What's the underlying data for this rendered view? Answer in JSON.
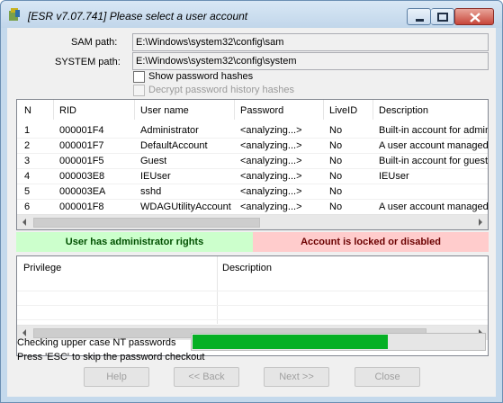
{
  "window": {
    "title": "[ESR v7.07.741]  Please select a user account"
  },
  "paths": {
    "sam_label": "SAM path:",
    "sam_value": "E:\\Windows\\system32\\config\\sam",
    "system_label": "SYSTEM path:",
    "system_value": "E:\\Windows\\system32\\config\\system"
  },
  "options": {
    "show_hashes": "Show password hashes",
    "show_hashes_checked": false,
    "decrypt_history": "Decrypt password history hashes",
    "decrypt_history_enabled": false
  },
  "accounts": {
    "columns": [
      "N",
      "RID",
      "User name",
      "Password",
      "LiveID",
      "Description"
    ],
    "rows": [
      [
        "1",
        "000001F4",
        "Administrator",
        "<analyzing...>",
        "No",
        "Built-in account for admin"
      ],
      [
        "2",
        "000001F7",
        "DefaultAccount",
        "<analyzing...>",
        "No",
        "A user account managed"
      ],
      [
        "3",
        "000001F5",
        "Guest",
        "<analyzing...>",
        "No",
        "Built-in account for guest"
      ],
      [
        "4",
        "000003E8",
        "IEUser",
        "<analyzing...>",
        "No",
        "IEUser"
      ],
      [
        "5",
        "000003EA",
        "sshd",
        "<analyzing...>",
        "No",
        ""
      ],
      [
        "6",
        "000001F8",
        "WDAGUtilityAccount",
        "<analyzing...>",
        "No",
        "A user account managed"
      ]
    ]
  },
  "status": {
    "admin": "User has administrator rights",
    "locked": "Account is locked or disabled"
  },
  "privileges": {
    "columns": [
      "Privilege",
      "Description"
    ]
  },
  "progress": {
    "label": "Checking upper case NT passwords",
    "hint": "Press 'ESC' to skip the password checkout",
    "fraction": 0.67
  },
  "buttons": {
    "help": "Help",
    "back": "<< Back",
    "next": "Next >>",
    "close": "Close"
  },
  "colors": {
    "admin_bg": "#ccffcc",
    "locked_bg": "#ffcccc",
    "progress_fill": "#06b025"
  }
}
